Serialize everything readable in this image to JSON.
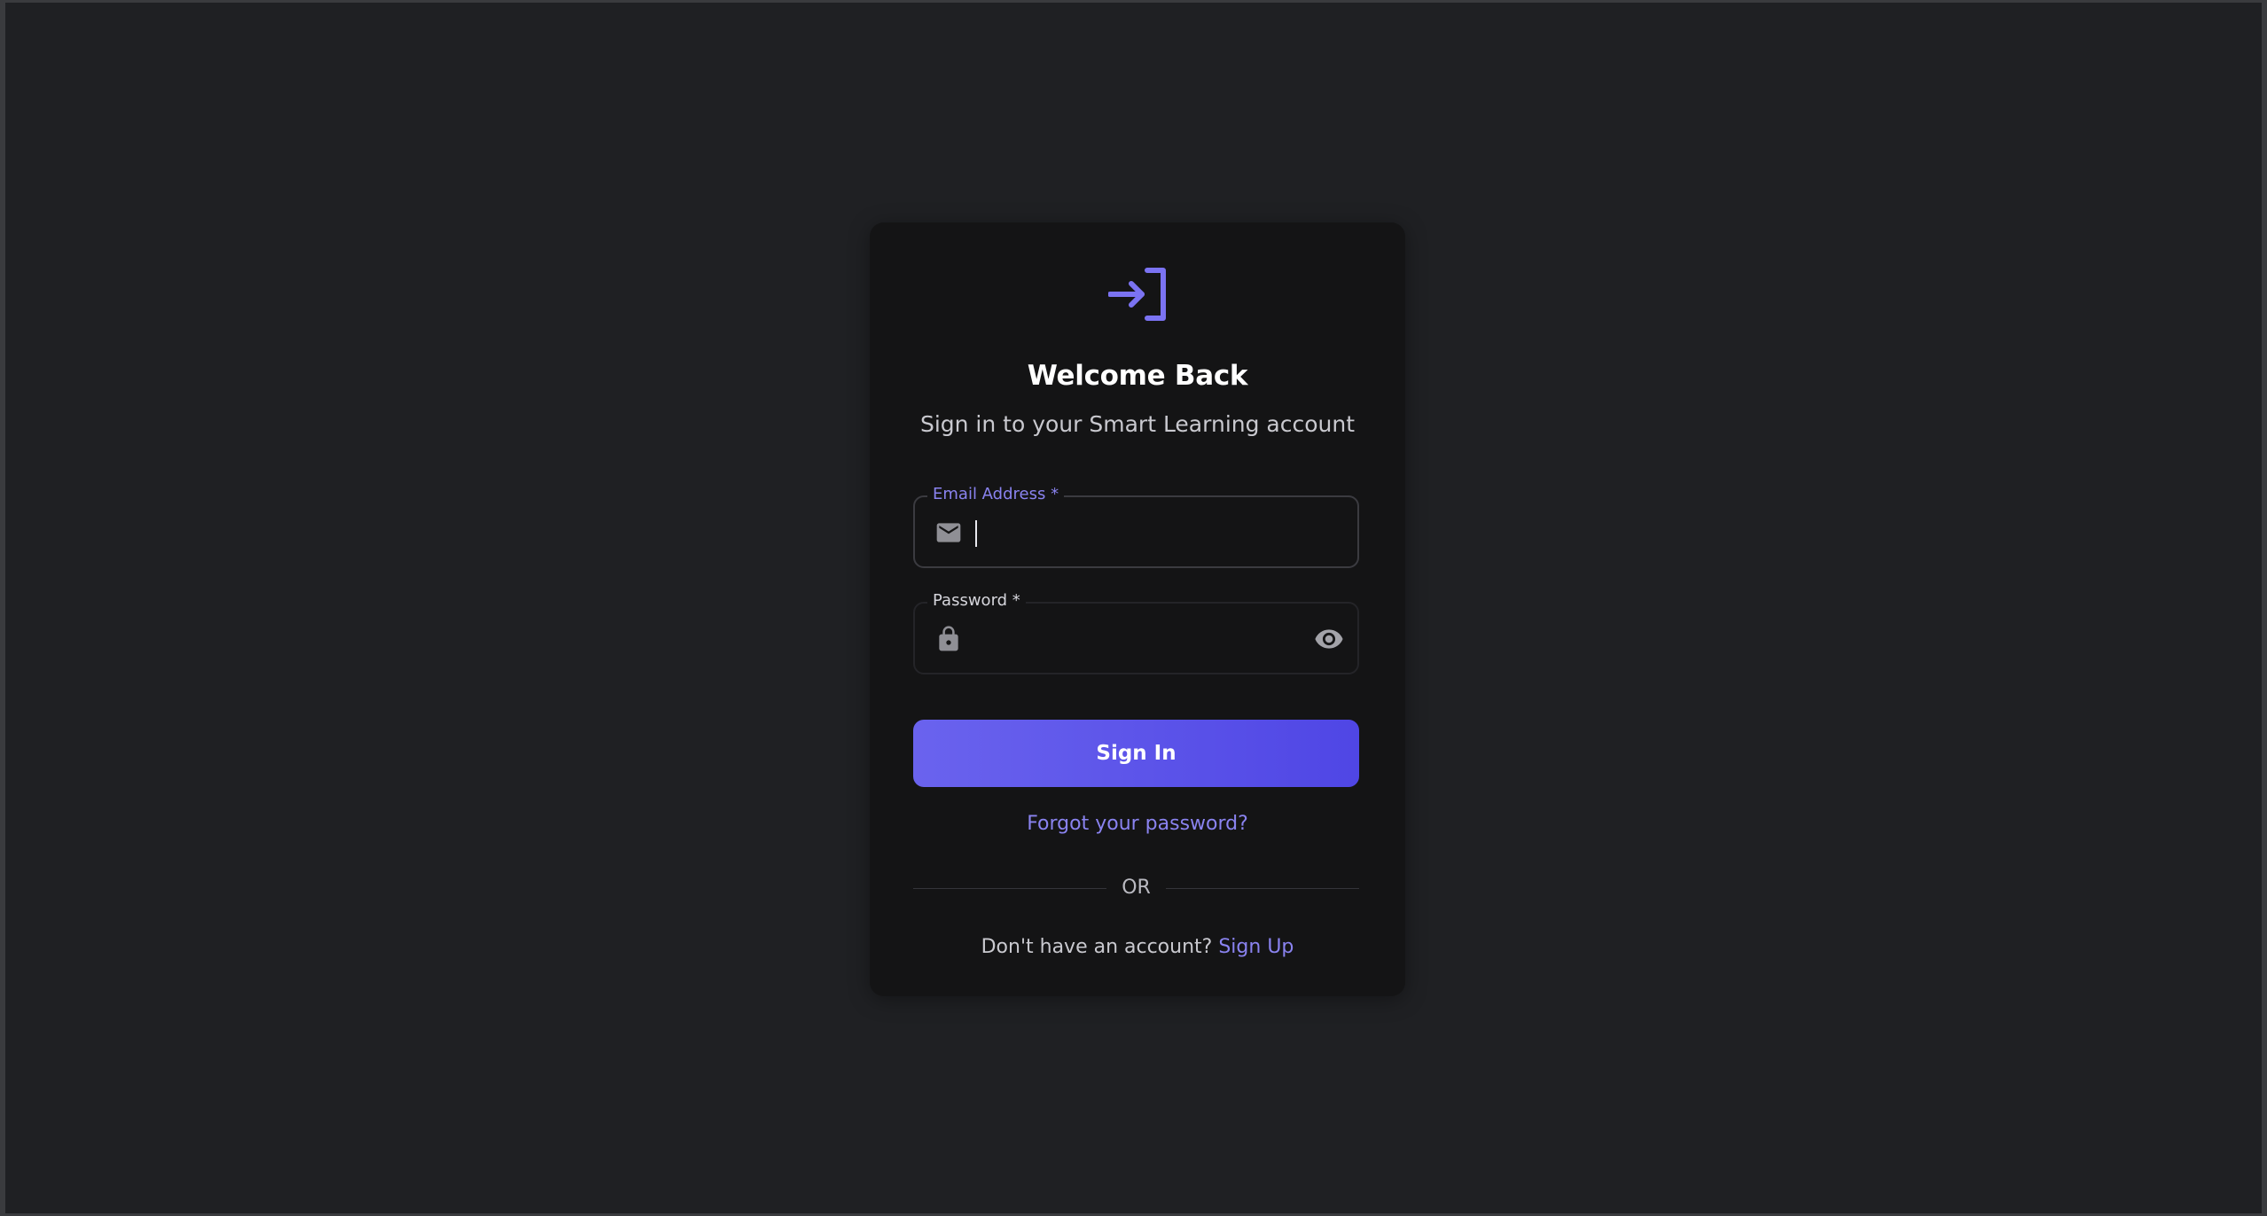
{
  "colors": {
    "background": "#1f2023",
    "card": "#141415",
    "accent": "#6366f1",
    "text_primary": "#ffffff",
    "text_secondary": "#c9c9cf"
  },
  "logo": {
    "icon": "login-icon"
  },
  "header": {
    "title": "Welcome Back",
    "subtitle": "Sign in to your Smart Learning account"
  },
  "form": {
    "email": {
      "label": "Email Address *",
      "value": "",
      "icon": "mail-icon",
      "focused": true
    },
    "password": {
      "label": "Password *",
      "value": "",
      "icon": "lock-icon",
      "toggle_icon": "eye-icon"
    },
    "submit_label": "Sign In"
  },
  "links": {
    "forgot_password": "Forgot your password?",
    "divider": "OR",
    "signup_prompt": "Don't have an account?",
    "signup_link": "Sign Up"
  }
}
